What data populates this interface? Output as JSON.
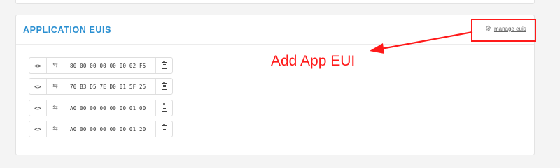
{
  "section": {
    "title": "APPLICATION EUIS",
    "manage_label": "manage euis",
    "manage_icon": "gear-icon"
  },
  "annotation": {
    "text": "Add App EUI",
    "color": "#ff1a1a"
  },
  "eui_rows": [
    {
      "code_label": "<>",
      "swap_icon": "⇆",
      "value": "80 00 00 00 00 00 02 F5",
      "copy_icon": "clipboard-icon"
    },
    {
      "code_label": "<>",
      "swap_icon": "⇆",
      "value": "70 B3 D5 7E D0 01 5F 25",
      "copy_icon": "clipboard-icon"
    },
    {
      "code_label": "<>",
      "swap_icon": "⇆",
      "value": "A0 00 00 00 00 00 01 00",
      "copy_icon": "clipboard-icon"
    },
    {
      "code_label": "<>",
      "swap_icon": "⇆",
      "value": "A0 00 00 00 00 00 01 20",
      "copy_icon": "clipboard-icon"
    }
  ],
  "colors": {
    "accent": "#2a8fd1",
    "annotation": "#ff1a1a"
  }
}
